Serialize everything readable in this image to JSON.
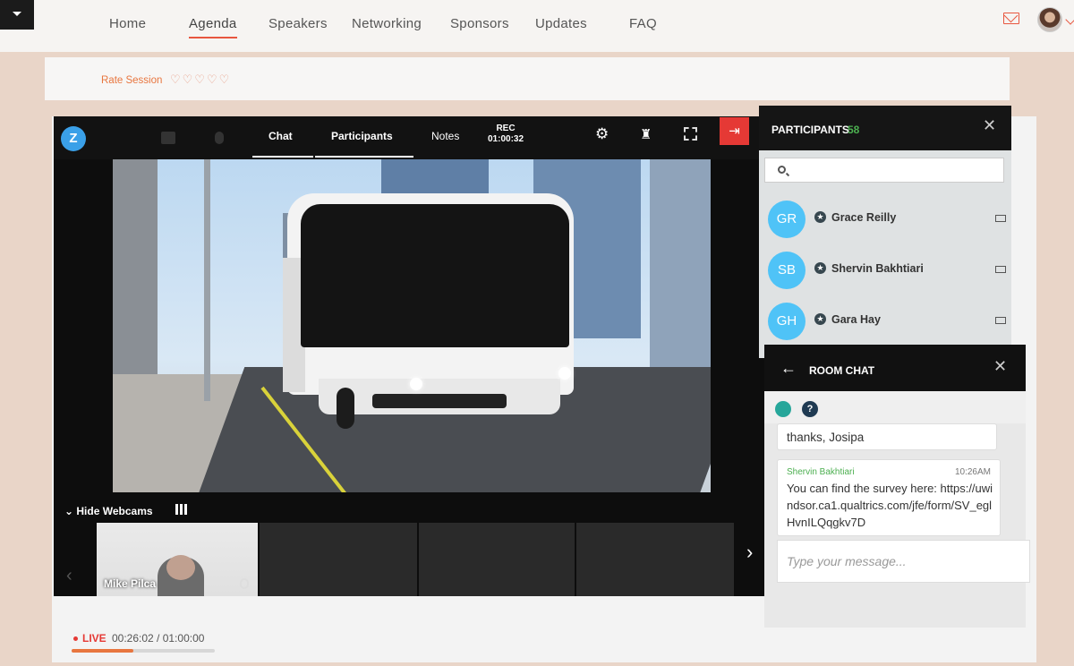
{
  "nav": {
    "items": [
      {
        "label": "Home",
        "active": false
      },
      {
        "label": "Agenda",
        "active": true
      },
      {
        "label": "Speakers",
        "active": false
      },
      {
        "label": "Networking",
        "active": false
      },
      {
        "label": "Sponsors",
        "active": false
      },
      {
        "label": "Updates",
        "active": false
      },
      {
        "label": "FAQ",
        "active": false
      }
    ]
  },
  "rate": {
    "label": "Rate Session",
    "hearts": "♡♡♡♡♡"
  },
  "player": {
    "logo": "Z",
    "tabs": {
      "chat": "Chat",
      "participants": "Participants",
      "notes": "Notes"
    },
    "rec_label": "REC",
    "rec_time": "01:00:32",
    "hide_webcams": "Hide Webcams",
    "webcam_name": "Mike Pilca"
  },
  "participants": {
    "title": "PARTICIPANTS",
    "count": "58",
    "search_placeholder": "",
    "list": [
      {
        "initials": "GR",
        "name": "Grace Reilly"
      },
      {
        "initials": "SB",
        "name": "Shervin Bakhtiari"
      },
      {
        "initials": "GH",
        "name": "Gara Hay"
      }
    ]
  },
  "chat": {
    "title": "ROOM CHAT",
    "messages": [
      {
        "text": "thanks, Josipa"
      },
      {
        "author": "Shervin Bakhtiari",
        "time": "10:26AM",
        "text": "You can find the survey here: https://uwindsor.ca1.qualtrics.com/jfe/form/SV_eglHvnILQqgkv7D"
      }
    ],
    "input_placeholder": "Type your message..."
  },
  "live": {
    "label": "LIVE",
    "time": "00:26:02 / 01:00:00",
    "progress": 0.434
  },
  "colors": {
    "accent": "#e8563f",
    "live": "#e53935",
    "participant_count": "#4caf50",
    "avatar": "#4fc3f7"
  },
  "icons": [
    "menu-caret-icon",
    "mail-icon",
    "user-avatar",
    "camera-icon",
    "mic-icon",
    "gear-icon",
    "seat-icon",
    "fullscreen-icon",
    "exit-icon",
    "search-icon",
    "star-icon",
    "device-icon",
    "back-arrow-icon",
    "close-icon",
    "emoji-icon",
    "help-icon",
    "grid-icon",
    "chevron-left-icon",
    "chevron-right-icon"
  ]
}
